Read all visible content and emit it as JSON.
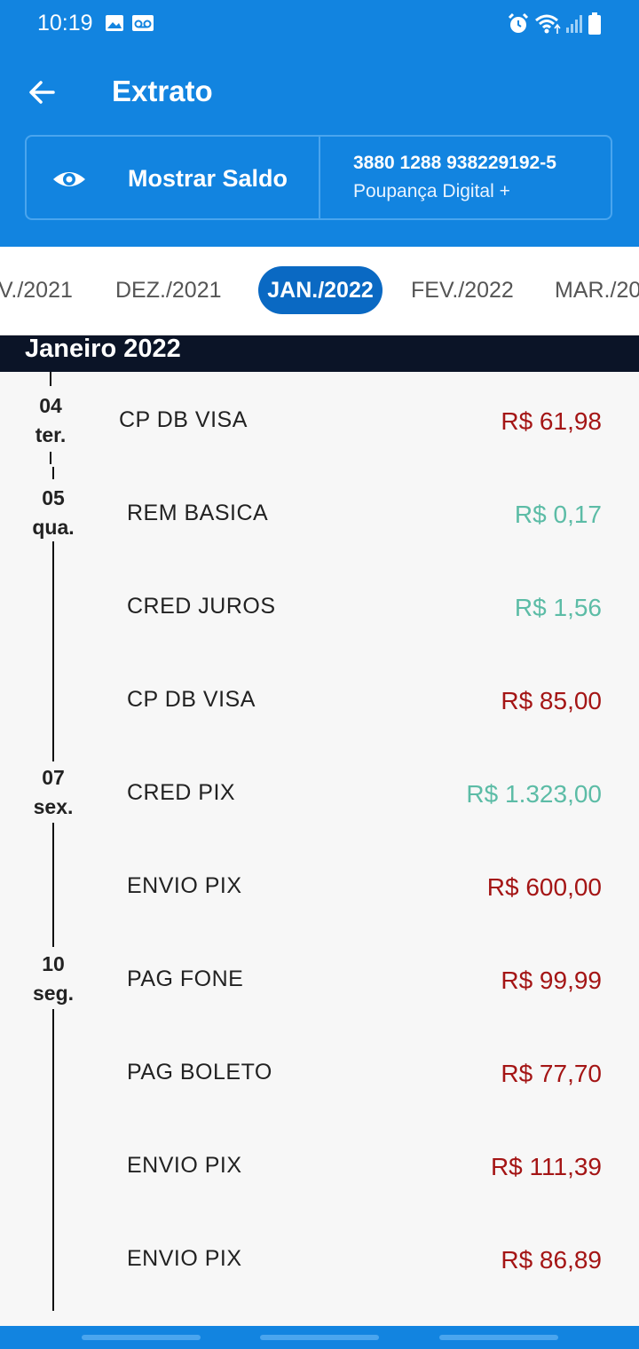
{
  "status_bar": {
    "time": "10:19",
    "icons": [
      "image-icon",
      "voicemail-icon",
      "alarm-icon",
      "wifi-icon",
      "signal-icon",
      "battery-icon"
    ]
  },
  "app_bar": {
    "back_icon": "arrow-left-icon",
    "title": "Extrato"
  },
  "account": {
    "show_balance_icon": "eye-icon",
    "show_balance_label": "Mostrar Saldo",
    "number": "3880 1288 938229192-5",
    "type": "Poupança Digital +"
  },
  "month_tabs": [
    {
      "label": "V./2021"
    },
    {
      "label": "DEZ./2021"
    },
    {
      "label": "JAN./2022",
      "selected": true
    },
    {
      "label": "FEV./2022"
    },
    {
      "label": "MAR./20"
    }
  ],
  "section_header": "Janeiro 2022",
  "days": [
    {
      "day": "04",
      "weekday": "ter."
    },
    {
      "day": "05",
      "weekday": "qua."
    },
    {
      "day": "07",
      "weekday": "sex."
    },
    {
      "day": "10",
      "weekday": "seg."
    }
  ],
  "transactions": [
    {
      "label": "CP DB VISA",
      "amount": "R$ 61,98",
      "type": "debit"
    },
    {
      "label": "REM BASICA",
      "amount": "R$ 0,17",
      "type": "credit"
    },
    {
      "label": "CRED JUROS",
      "amount": "R$ 1,56",
      "type": "credit"
    },
    {
      "label": "CP DB VISA",
      "amount": "R$ 85,00",
      "type": "debit"
    },
    {
      "label": "CRED PIX",
      "amount": "R$ 1.323,00",
      "type": "credit"
    },
    {
      "label": "ENVIO PIX",
      "amount": "R$ 600,00",
      "type": "debit"
    },
    {
      "label": "PAG FONE",
      "amount": "R$ 99,99",
      "type": "debit"
    },
    {
      "label": "PAG BOLETO",
      "amount": "R$ 77,70",
      "type": "debit"
    },
    {
      "label": "ENVIO PIX",
      "amount": "R$ 111,39",
      "type": "debit"
    },
    {
      "label": "ENVIO PIX",
      "amount": "R$ 86,89",
      "type": "debit"
    }
  ],
  "colors": {
    "primary": "#1284e0",
    "tab_selected": "#0a69c3",
    "section_header_bg": "#0b1427",
    "debit": "#a41515",
    "credit": "#5cbca6"
  }
}
